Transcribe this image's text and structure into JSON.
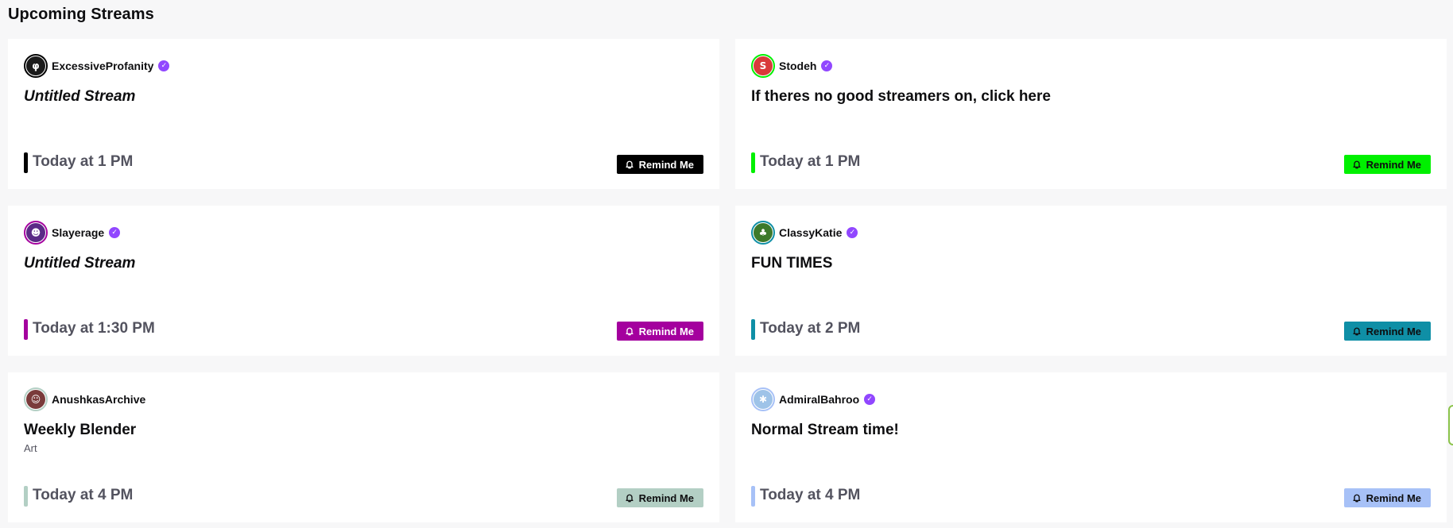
{
  "section": {
    "title": "Upcoming Streams"
  },
  "remind_label": "Remind Me",
  "cards": [
    {
      "streamer": "ExcessiveProfanity",
      "verified": true,
      "title": "Untitled Stream",
      "untitled": true,
      "category": "",
      "time": "Today at 1 PM",
      "accent": "#000000",
      "button_text_color": "#ffffff",
      "avatar_color": "#1a1a1a",
      "avatar_glyph": "φ"
    },
    {
      "streamer": "Stodeh",
      "verified": true,
      "title": "If theres no good streamers on, click here",
      "untitled": false,
      "category": "",
      "time": "Today at 1 PM",
      "accent": "#00f000",
      "button_text_color": "#0e0e10",
      "avatar_color": "#d93a3a",
      "avatar_glyph": "S"
    },
    {
      "streamer": "Slayerage",
      "verified": true,
      "title": "Untitled Stream",
      "untitled": true,
      "category": "",
      "time": "Today at 1:30 PM",
      "accent": "#a4009e",
      "button_text_color": "#ffffff",
      "avatar_color": "#5b2a86",
      "avatar_glyph": "☻"
    },
    {
      "streamer": "ClassyKatie",
      "verified": true,
      "title": "FUN TIMES",
      "untitled": false,
      "category": "",
      "time": "Today at 2 PM",
      "accent": "#0f8fa6",
      "button_text_color": "#0e0e10",
      "avatar_color": "#3d7a2c",
      "avatar_glyph": "♣"
    },
    {
      "streamer": "AnushkasArchive",
      "verified": false,
      "title": "Weekly Blender",
      "untitled": false,
      "category": "Art",
      "time": "Today at 4 PM",
      "accent": "#b3cfc4",
      "button_text_color": "#0e0e10",
      "avatar_color": "#7a3b3b",
      "avatar_glyph": "☺"
    },
    {
      "streamer": "AdmiralBahroo",
      "verified": true,
      "title": "Normal Stream time!",
      "untitled": false,
      "category": "",
      "time": "Today at 4 PM",
      "accent": "#a7c1f7",
      "button_text_color": "#0e0e10",
      "avatar_color": "#9ec3e8",
      "avatar_glyph": "✱"
    }
  ]
}
